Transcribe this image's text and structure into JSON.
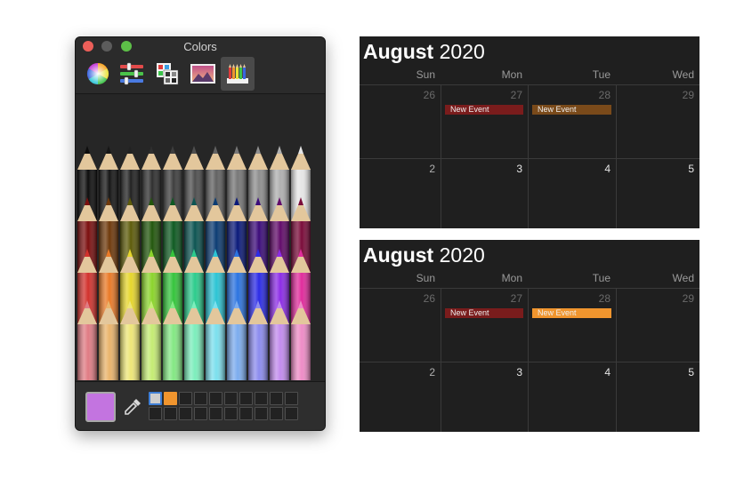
{
  "colors_panel": {
    "title": "Colors",
    "tabs": [
      {
        "name": "color-wheel",
        "icon": "color-wheel-icon"
      },
      {
        "name": "sliders",
        "icon": "sliders-icon"
      },
      {
        "name": "palettes",
        "icon": "palettes-icon"
      },
      {
        "name": "image-palettes",
        "icon": "image-palettes-icon"
      },
      {
        "name": "pencils",
        "icon": "pencils-icon",
        "selected": true
      }
    ],
    "current_color": "#c374e0",
    "pencil_rows": [
      [
        "#0d0d0d",
        "#161616",
        "#222222",
        "#2f2f2f",
        "#3e3e3e",
        "#4f4f4f",
        "#626262",
        "#777777",
        "#8f8f8f",
        "#b0b0b0",
        "#e6e6e6"
      ],
      [
        "#7b0f0f",
        "#6f3a0c",
        "#5e5c0b",
        "#23570d",
        "#0f5a22",
        "#0d5552",
        "#0c3c73",
        "#0b1a7a",
        "#3c0c7a",
        "#620c6a",
        "#7a0c3a"
      ],
      [
        "#d2322d",
        "#ea7a28",
        "#e6d62c",
        "#8bd42c",
        "#35c43c",
        "#2ccc8c",
        "#2cc4d4",
        "#2c74e0",
        "#2c2ce6",
        "#8c2ce6",
        "#e02c9c"
      ],
      [
        "#e07c84",
        "#eab46c",
        "#eee678",
        "#c4ec74",
        "#84e884",
        "#7ceebc",
        "#7ce0ee",
        "#7cacee",
        "#8c8cee",
        "#c28cee",
        "#ee8cc6"
      ]
    ],
    "favorites": [
      "#cfcfcf",
      "#f0952e"
    ]
  },
  "calendars": [
    {
      "month": "August",
      "year": "2020",
      "day_headers": [
        "Sun",
        "Mon",
        "Tue",
        "Wed"
      ],
      "week1_dates": [
        "26",
        "27",
        "28",
        "29"
      ],
      "week2_dates": [
        "2",
        "3",
        "4",
        "5"
      ],
      "events": [
        {
          "label": "New Event",
          "day": "Mon",
          "color": "#7a1c1c"
        },
        {
          "label": "New Event",
          "day": "Tue",
          "color": "#7a4a1a"
        }
      ]
    },
    {
      "month": "August",
      "year": "2020",
      "day_headers": [
        "Sun",
        "Mon",
        "Tue",
        "Wed"
      ],
      "week1_dates": [
        "26",
        "27",
        "28",
        "29"
      ],
      "week2_dates": [
        "2",
        "3",
        "4",
        "5"
      ],
      "events": [
        {
          "label": "New Event",
          "day": "Mon",
          "color": "#7a1c1c"
        },
        {
          "label": "New Event",
          "day": "Tue",
          "color": "#f0952e"
        }
      ]
    }
  ]
}
